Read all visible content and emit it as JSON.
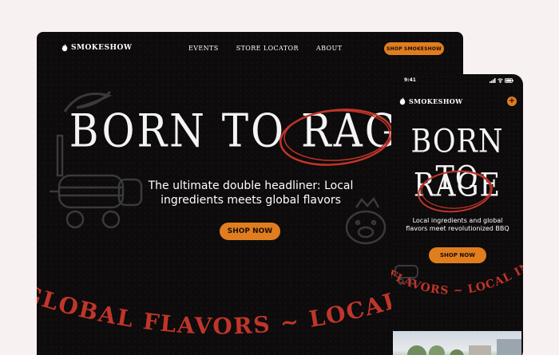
{
  "desktop": {
    "brand": "SMOKESHOW",
    "nav": [
      "EVENTS",
      "STORE LOCATOR",
      "ABOUT"
    ],
    "cta_label": "SHOP SMOKESHOW",
    "hero_title_part1": "BORN TO",
    "hero_title_part2": "RAGE",
    "hero_subtitle": "The ultimate double headliner: Local ingredients meets global flavors",
    "shop_label": "SHOP NOW",
    "arc_text": "GLOBAL FLAVORS ~ LOCAL INGREDIENTS"
  },
  "mobile": {
    "time": "9:41",
    "brand": "SMOKESHOW",
    "plus_label": "+",
    "hero_line1": "BORN TO",
    "hero_line2": "RAGE",
    "hero_subtitle": "Local ingredients and global flavors meet revolutionized BBQ",
    "shop_label": "SHOP NOW",
    "arc_text": "FLAVORS ~ LOCAL ING"
  },
  "colors": {
    "background": "#f8f1f2",
    "panel": "#0d0b0b",
    "accent": "#e07d1f",
    "accent_red": "#c0352b",
    "text": "#ffffff"
  },
  "icons": [
    "flame-icon",
    "signal-icon",
    "wifi-icon",
    "battery-icon",
    "plus-icon"
  ]
}
